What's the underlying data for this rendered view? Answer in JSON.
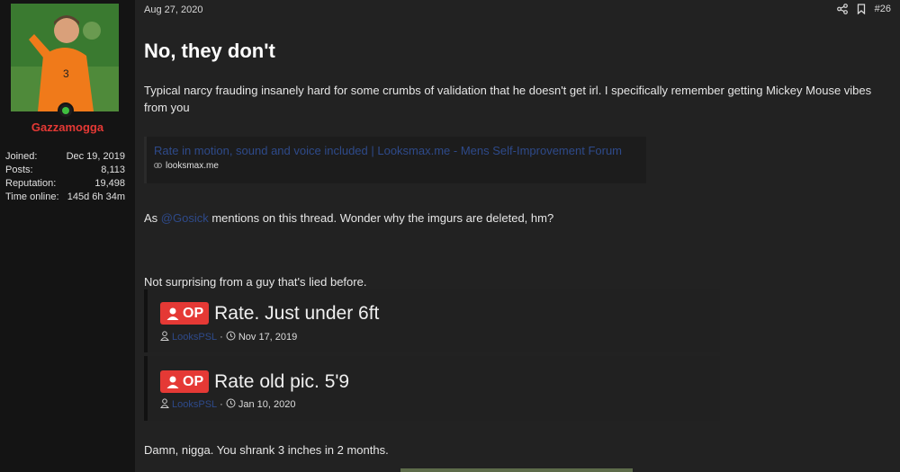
{
  "post": {
    "date": "Aug 27, 2020",
    "number": "#26",
    "title": "No, they don't",
    "body_1": "Typical narcy frauding insanely hard for some crumbs of validation that he doesn't get irl. I specifically remember getting Mickey Mouse vibes from you",
    "embed": {
      "title": "Rate in motion, sound and voice included | Looksmax.me - Mens Self-Improvement Forum",
      "domain": "looksmax.me"
    },
    "body_2_prefix": "As ",
    "body_2_mention": "@Gosick",
    "body_2_suffix": " mentions on this thread. Wonder why the imgurs are deleted, hm?",
    "body_3": "Not surprising from a guy that's lied before.",
    "quotes": [
      {
        "badge": "OP",
        "title": "Rate. Just under 6ft",
        "author": "LooksPSL",
        "date": "Nov 17, 2019"
      },
      {
        "badge": "OP",
        "title": "Rate old pic. 5'9",
        "author": "LooksPSL",
        "date": "Jan 10, 2020"
      }
    ],
    "body_4": "Damn, nigga. You shrank 3 inches in 2 months."
  },
  "user": {
    "name": "Gazzamogga",
    "stats": [
      {
        "label": "Joined:",
        "value": "Dec 19, 2019"
      },
      {
        "label": "Posts:",
        "value": "8,113"
      },
      {
        "label": "Reputation:",
        "value": "19,498"
      },
      {
        "label": "Time online:",
        "value": "145d 6h 34m"
      }
    ]
  },
  "colors": {
    "accent_red": "#e53935",
    "link_blue": "#2e4a8a",
    "online_green": "#3fbf3f"
  },
  "icons": [
    "share-icon",
    "bookmark-icon",
    "link-icon",
    "user-icon",
    "clock-icon",
    "online-status-icon"
  ]
}
